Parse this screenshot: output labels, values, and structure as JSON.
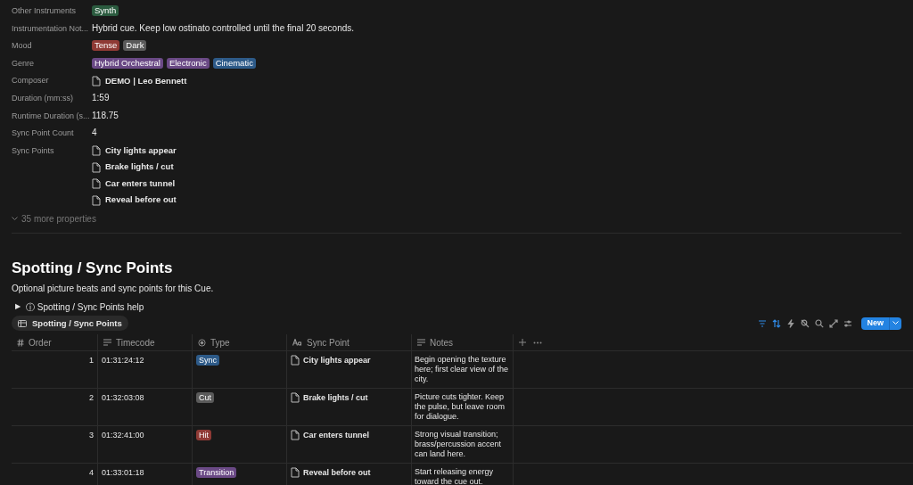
{
  "properties": [
    {
      "label": "Other Instruments",
      "kind": "tags",
      "tags": [
        {
          "text": "Synth",
          "color": "#2b5b3f"
        }
      ]
    },
    {
      "label": "Instrumentation Not...",
      "kind": "text",
      "value": "Hybrid cue. Keep low ostinato controlled until the final 20 seconds."
    },
    {
      "label": "Mood",
      "kind": "tags",
      "tags": [
        {
          "text": "Tense",
          "color": "#8f3a35"
        },
        {
          "text": "Dark",
          "color": "#5a5a5a"
        }
      ]
    },
    {
      "label": "Genre",
      "kind": "tags",
      "tags": [
        {
          "text": "Hybrid Orchestral",
          "color": "#6a4985"
        },
        {
          "text": "Electronic",
          "color": "#6a4985"
        },
        {
          "text": "Cinematic",
          "color": "#2d5a88"
        }
      ]
    },
    {
      "label": "Composer",
      "kind": "pages",
      "pages": [
        "DEMO | Leo Bennett"
      ]
    },
    {
      "label": "Duration (mm:ss)",
      "kind": "text",
      "value": "1:59"
    },
    {
      "label": "Runtime Duration (s...",
      "kind": "text",
      "value": "118.75"
    },
    {
      "label": "Sync Point Count",
      "kind": "text",
      "value": "4"
    },
    {
      "label": "Sync Points",
      "kind": "pages",
      "pages": [
        "City lights appear",
        "Brake lights / cut",
        "Car enters tunnel",
        "Reveal before out"
      ]
    }
  ],
  "more_properties": "35 more properties",
  "section": {
    "title": "Spotting / Sync Points",
    "description": "Optional picture beats and sync points for this Cue.",
    "help_toggle": {
      "arrow": "▶",
      "label": "ⓘ Spotting / Sync Points help",
      "expanded": false
    }
  },
  "view_tab": {
    "label": "Spotting / Sync Points",
    "selected": true
  },
  "toolbar": {
    "new_button": "New"
  },
  "table": {
    "columns": [
      {
        "label": "Order",
        "kind": "number"
      },
      {
        "label": "Timecode",
        "kind": "text"
      },
      {
        "label": "Type",
        "kind": "select"
      },
      {
        "label": "Sync Point",
        "kind": "title"
      },
      {
        "label": "Notes",
        "kind": "text"
      }
    ],
    "rows": [
      {
        "order": "1",
        "timecode": "01:31:24:12",
        "type": {
          "text": "Sync",
          "color": "#2d5a88"
        },
        "sync_point": "City lights appear",
        "notes": "Begin opening the texture here; first clear view of the city."
      },
      {
        "order": "2",
        "timecode": "01:32:03:08",
        "type": {
          "text": "Cut",
          "color": "#5a5a5a"
        },
        "sync_point": "Brake lights / cut",
        "notes": "Picture cuts tighter. Keep the pulse, but leave room for dialogue."
      },
      {
        "order": "3",
        "timecode": "01:32:41:00",
        "type": {
          "text": "Hit",
          "color": "#8f3a35"
        },
        "sync_point": "Car enters tunnel",
        "notes": "Strong visual transition; brass/percussion accent can land here."
      },
      {
        "order": "4",
        "timecode": "01:33:01:18",
        "type": {
          "text": "Transition",
          "color": "#6a4985"
        },
        "sync_point": "Reveal before out",
        "notes": "Start releasing energy toward the cue out."
      }
    ]
  }
}
